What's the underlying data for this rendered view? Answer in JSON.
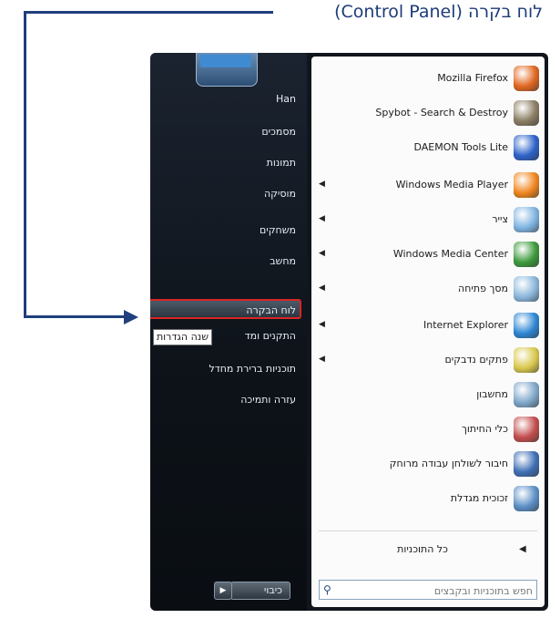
{
  "caption": "לוח בקרה (Control Panel)",
  "start_menu": {
    "places": [
      {
        "label": "Han",
        "id": "user"
      },
      {
        "label": "מסמכים",
        "id": "documents"
      },
      {
        "label": "תמונות",
        "id": "pictures"
      },
      {
        "label": "מוסיקה",
        "id": "music"
      },
      {
        "label": "משחקים",
        "id": "games"
      },
      {
        "label": "מחשב",
        "id": "computer"
      },
      {
        "label": "לוח הבקרה",
        "id": "control-panel"
      },
      {
        "label": "התקנים ומד",
        "id": "devices"
      },
      {
        "label": "תוכניות ברירת מחדל",
        "id": "default-programs"
      },
      {
        "label": "עזרה ותמיכה",
        "id": "help"
      }
    ],
    "tooltip": "שנה הגדרות",
    "shutdown": {
      "label": "כיבוי",
      "arrow": "▶"
    },
    "programs": [
      {
        "label": "Mozilla Firefox",
        "icon": "firefox-icon",
        "color": "#e0661f",
        "submenu": false
      },
      {
        "label": "Spybot - Search & Destroy",
        "icon": "spybot-icon",
        "color": "#8a7d63",
        "submenu": false
      },
      {
        "label": "DAEMON Tools Lite",
        "icon": "daemon-tools-icon",
        "color": "#2d62c9",
        "submenu": false
      },
      {
        "label": "Windows Media Player",
        "icon": "media-player-icon",
        "color": "#f0851d",
        "submenu": true
      },
      {
        "label": "צייר",
        "icon": "paint-icon",
        "color": "#7fb4e1",
        "submenu": true
      },
      {
        "label": "Windows Media Center",
        "icon": "media-center-icon",
        "color": "#3c9a3c",
        "submenu": true
      },
      {
        "label": "מסך פתיחה",
        "icon": "getting-started-icon",
        "color": "#8bb6dc",
        "submenu": true
      },
      {
        "label": "Internet Explorer",
        "icon": "internet-explorer-icon",
        "color": "#2e86d3",
        "submenu": true
      },
      {
        "label": "פתקים נדבקים",
        "icon": "sticky-notes-icon",
        "color": "#d9c84c",
        "submenu": true
      },
      {
        "label": "מחשבון",
        "icon": "calculator-icon",
        "color": "#7fa7c9",
        "submenu": false
      },
      {
        "label": "כלי החיתוך",
        "icon": "snipping-tool-icon",
        "color": "#c34d4d",
        "submenu": false
      },
      {
        "label": "חיבור לשולחן עבודה מרוחק",
        "icon": "remote-desktop-icon",
        "color": "#3f6fb5",
        "submenu": false
      },
      {
        "label": "זכוכית מגדלת",
        "icon": "magnifier-icon",
        "color": "#5b8fc6",
        "submenu": false
      }
    ],
    "all_programs": {
      "label": "כל התוכניות",
      "arrow": "◀"
    },
    "search_placeholder": "חפש בתוכניות ובקבצים",
    "search_icon": "⚲"
  }
}
